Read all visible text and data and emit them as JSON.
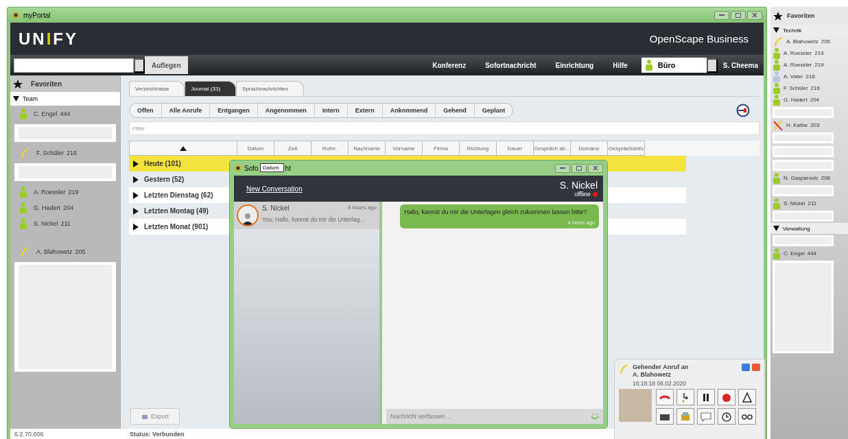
{
  "window": {
    "title": "myPortal"
  },
  "header": {
    "logo": [
      {
        "text": "UN",
        "accent": false
      },
      {
        "text": "I",
        "accent": true
      },
      {
        "text": "FY",
        "accent": false
      }
    ],
    "product": "OpenScape Business"
  },
  "toolbar": {
    "hangup": "Auflegen",
    "menu": [
      "Konferenz",
      "Sofortnachricht",
      "Einrichtung",
      "Hilfe"
    ],
    "presence": "Büro",
    "user": "S. Cheema"
  },
  "sidebar": {
    "title": "Favoriten",
    "groups": [
      {
        "label": "Team",
        "expanded": true,
        "items": [
          {
            "kind": "available",
            "name": "C. Engel",
            "ext": "444"
          },
          {
            "kind": "blank"
          },
          {
            "kind": "calling",
            "name": "F. Schüler",
            "ext": "216"
          },
          {
            "kind": "blank"
          },
          {
            "kind": "available",
            "name": "A. Roessler",
            "ext": "219"
          },
          {
            "kind": "available",
            "name": "G. Hadert",
            "ext": "204"
          },
          {
            "kind": "available",
            "name": "S. Nickel",
            "ext": "211"
          },
          {
            "kind": "gap"
          },
          {
            "kind": "calling",
            "name": "A. Blahowetz",
            "ext": "205"
          },
          {
            "kind": "tall-blank"
          }
        ]
      }
    ]
  },
  "tabs": [
    {
      "label": "Verzeichnisse",
      "selected": false
    },
    {
      "label": "Journal (33)",
      "selected": true
    },
    {
      "label": "Sprachnachrichten",
      "selected": false
    }
  ],
  "filters": [
    "Offen",
    "Alle Anrufe",
    "Entgangen",
    "Angenommen",
    "Intern",
    "Extern",
    "Ankommend",
    "Gehend",
    "Geplant"
  ],
  "filter_field": {
    "placeholder": "Filter"
  },
  "table": {
    "columns": [
      "Datum",
      "Zeit",
      "Rufnr.",
      "Nachname",
      "Vorname",
      "Firma",
      "Richtung",
      "Dauer",
      "Gespräch ab...",
      "Domäne",
      "Gesprächsinfo"
    ],
    "groups": [
      {
        "label": "Heute (101)",
        "selected": true
      },
      {
        "label": "Gestern (52)",
        "selected": false
      },
      {
        "label": "Letzten Dienstag (62)",
        "selected": false
      },
      {
        "label": "Letzten Montag (49)",
        "selected": false
      },
      {
        "label": "Letzten Monat (901)",
        "selected": false
      }
    ]
  },
  "export_button": "Export",
  "status_bar": {
    "version": "6.2.70.006",
    "status": "Status: Verbunden"
  },
  "chat": {
    "title_parts": [
      "Sofo",
      "ht"
    ],
    "tooltip": "Datum",
    "new_conversation": "New Conversation",
    "contact": {
      "name": "S. Nickel",
      "status": "offline",
      "online": false
    },
    "conversations": [
      {
        "name": "S. Nickel",
        "time": "4 hours ago",
        "preview": "You: Hallo, kannst du mir die Unterlag...",
        "selected": true
      }
    ],
    "messages": [
      {
        "text": "Hallo, kannst du mir die Unterlagen gleich zukommen lassen bitte?",
        "time": "4 hours ago",
        "outgoing": true
      }
    ],
    "composer": {
      "placeholder": "Nachricht verfassen ..."
    }
  },
  "call": {
    "title": "Gehender Anruf an",
    "party": "A. Blahowetz",
    "time": "16:18:18 06.02.2020",
    "actions": [
      {
        "kind": "hangup"
      },
      {
        "kind": "transfer"
      },
      {
        "kind": "hold"
      },
      {
        "kind": "record"
      },
      {
        "kind": "conference"
      },
      {
        "kind": "mail"
      },
      {
        "kind": "voicemail"
      },
      {
        "kind": "chat"
      },
      {
        "kind": "callback"
      },
      {
        "kind": "link"
      }
    ]
  },
  "favorites_panel": {
    "title": "Favoriten",
    "groups": [
      {
        "label": "Technik",
        "expanded": true,
        "items": [
          {
            "kind": "calling",
            "name": "A. Blahowetz",
            "ext": "205"
          },
          {
            "kind": "available",
            "name": "A. Roessler",
            "ext": "219"
          },
          {
            "kind": "available",
            "name": "A. Roessler",
            "ext": "219"
          },
          {
            "kind": "offline",
            "name": "A. Vater",
            "ext": "218"
          },
          {
            "kind": "available",
            "name": "F. Schüler",
            "ext": "216"
          },
          {
            "kind": "available",
            "name": "G. Hadert",
            "ext": "204"
          },
          {
            "kind": "blank"
          },
          {
            "kind": "dnd",
            "name": "H. Kathe",
            "ext": "203"
          },
          {
            "kind": "blank"
          },
          {
            "kind": "blank"
          },
          {
            "kind": "blank"
          },
          {
            "kind": "available",
            "name": "N. Gasparovic",
            "ext": "208"
          },
          {
            "kind": "blank"
          },
          {
            "kind": "available",
            "name": "S. Nickel",
            "ext": "211"
          },
          {
            "kind": "blank"
          }
        ]
      },
      {
        "label": "Verwaltung",
        "expanded": true,
        "items": [
          {
            "kind": "blank"
          },
          {
            "kind": "available",
            "name": "C. Engel",
            "ext": "444"
          },
          {
            "kind": "tall-blank"
          }
        ]
      }
    ]
  }
}
